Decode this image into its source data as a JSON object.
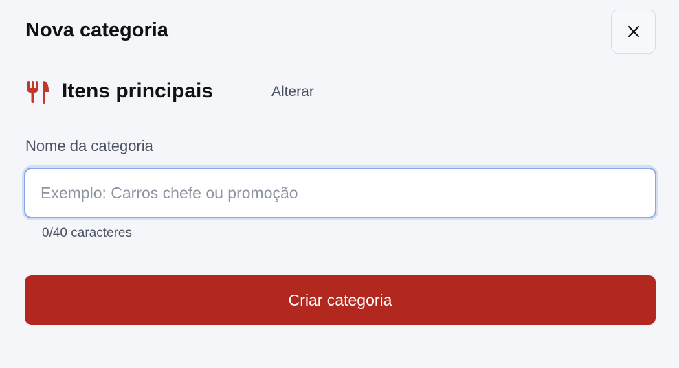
{
  "modal": {
    "title": "Nova categoria",
    "close_icon": "close-icon"
  },
  "category_type": {
    "icon": "fork-knife-icon",
    "icon_color": "#c0392b",
    "name": "Itens principais",
    "change_label": "Alterar"
  },
  "form": {
    "label": "Nome da categoria",
    "input_value": "",
    "input_placeholder": "Exemplo: Carros chefe ou promoção",
    "char_count": "0/40 caracteres"
  },
  "actions": {
    "submit_label": "Criar categoria",
    "submit_color": "#b3281e"
  }
}
